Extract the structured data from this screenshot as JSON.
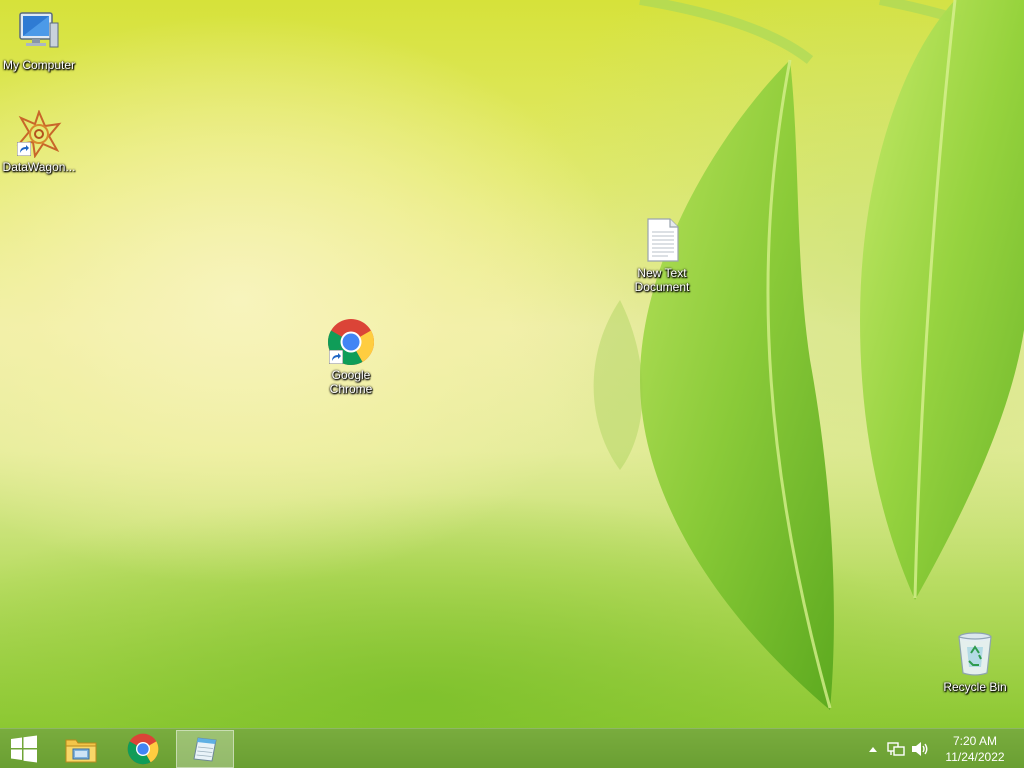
{
  "desktop": {
    "icons": [
      {
        "label": "My Computer",
        "icon": "computer-icon"
      },
      {
        "label": "DataWagon...",
        "icon": "datawagon-icon"
      },
      {
        "label": "New Text Document",
        "icon": "text-document-icon"
      },
      {
        "label": "Google Chrome",
        "icon": "chrome-icon"
      },
      {
        "label": "Recycle Bin",
        "icon": "recycle-bin-icon"
      }
    ]
  },
  "taskbar": {
    "start_icon": "windows-logo-icon",
    "pinned": [
      {
        "icon": "file-explorer-icon",
        "active": false
      },
      {
        "icon": "chrome-icon",
        "active": false
      },
      {
        "icon": "notepad-icon",
        "active": true
      }
    ],
    "tray": {
      "icons": [
        "chevron-up-icon",
        "network-icon",
        "volume-icon"
      ]
    },
    "clock": {
      "time": "7:20 AM",
      "date": "11/24/2022"
    }
  },
  "colors": {
    "taskbar": "#6fa437",
    "wallpaper_top": "#d6e23a",
    "wallpaper_center": "#efeea8",
    "leaf": "#7cc42c"
  }
}
